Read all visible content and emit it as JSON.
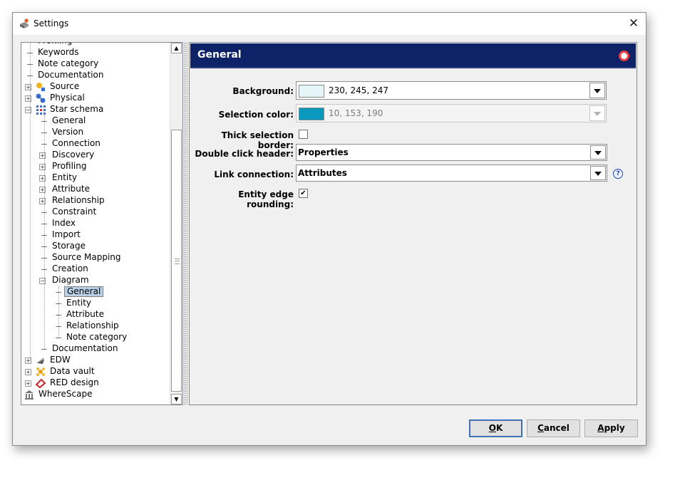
{
  "window": {
    "title": "Settings",
    "close_glyph": "✕"
  },
  "tree": {
    "items": [
      {
        "label": "Profiling",
        "level": 0,
        "expander": "",
        "icon": ""
      },
      {
        "label": "Keywords",
        "level": 0,
        "expander": "",
        "icon": ""
      },
      {
        "label": "Note category",
        "level": 0,
        "expander": "",
        "icon": ""
      },
      {
        "label": "Documentation",
        "level": 0,
        "expander": "",
        "icon": ""
      },
      {
        "label": "Source",
        "level": 0,
        "expander": "+",
        "icon": "source-icon"
      },
      {
        "label": "Physical",
        "level": 0,
        "expander": "+",
        "icon": "physical-icon"
      },
      {
        "label": "Star schema",
        "level": 0,
        "expander": "-",
        "icon": "star-schema-icon"
      },
      {
        "label": "General",
        "level": 1,
        "expander": "",
        "icon": ""
      },
      {
        "label": "Version",
        "level": 1,
        "expander": "",
        "icon": ""
      },
      {
        "label": "Connection",
        "level": 1,
        "expander": "",
        "icon": ""
      },
      {
        "label": "Discovery",
        "level": 1,
        "expander": "+",
        "icon": ""
      },
      {
        "label": "Profiling",
        "level": 1,
        "expander": "+",
        "icon": ""
      },
      {
        "label": "Entity",
        "level": 1,
        "expander": "+",
        "icon": ""
      },
      {
        "label": "Attribute",
        "level": 1,
        "expander": "+",
        "icon": ""
      },
      {
        "label": "Relationship",
        "level": 1,
        "expander": "+",
        "icon": ""
      },
      {
        "label": "Constraint",
        "level": 1,
        "expander": "",
        "icon": ""
      },
      {
        "label": "Index",
        "level": 1,
        "expander": "",
        "icon": ""
      },
      {
        "label": "Import",
        "level": 1,
        "expander": "",
        "icon": ""
      },
      {
        "label": "Storage",
        "level": 1,
        "expander": "",
        "icon": ""
      },
      {
        "label": "Source Mapping",
        "level": 1,
        "expander": "",
        "icon": ""
      },
      {
        "label": "Creation",
        "level": 1,
        "expander": "",
        "icon": ""
      },
      {
        "label": "Diagram",
        "level": 1,
        "expander": "-",
        "icon": ""
      },
      {
        "label": "General",
        "level": 2,
        "expander": "",
        "icon": "",
        "selected": true
      },
      {
        "label": "Entity",
        "level": 2,
        "expander": "",
        "icon": ""
      },
      {
        "label": "Attribute",
        "level": 2,
        "expander": "",
        "icon": ""
      },
      {
        "label": "Relationship",
        "level": 2,
        "expander": "",
        "icon": ""
      },
      {
        "label": "Note category",
        "level": 2,
        "expander": "",
        "icon": ""
      },
      {
        "label": "Documentation",
        "level": 1,
        "expander": "",
        "icon": ""
      },
      {
        "label": "EDW",
        "level": 0,
        "expander": "+",
        "icon": "edw-icon"
      },
      {
        "label": "Data vault",
        "level": 0,
        "expander": "+",
        "icon": "data-vault-icon"
      },
      {
        "label": "RED design",
        "level": 0,
        "expander": "+",
        "icon": "red-design-icon"
      },
      {
        "label": "WhereScape",
        "level": -1,
        "expander": "",
        "icon": "wherescape-icon"
      }
    ]
  },
  "panel": {
    "title": "General",
    "fields": {
      "background": {
        "label": "Background:",
        "value": "230, 245, 247",
        "color": "#e6f5f7"
      },
      "selection_color": {
        "label": "Selection color:",
        "value": "10, 153, 190",
        "color": "#0a99be"
      },
      "thick_selection_border": {
        "label": "Thick selection border:",
        "checked": false
      },
      "double_click_header": {
        "label": "Double click header:",
        "value": "Properties"
      },
      "link_connection": {
        "label": "Link connection:",
        "value": "Attributes"
      },
      "entity_edge_rounding": {
        "label": "Entity edge rounding:",
        "checked": true
      }
    }
  },
  "buttons": {
    "ok": {
      "u": "O",
      "rest": "K"
    },
    "cancel": {
      "u": "C",
      "rest": "ancel"
    },
    "apply": {
      "u": "A",
      "rest": "pply"
    }
  },
  "colors": {
    "header_bg": "#0e2367",
    "selected_row": "#b8cfe5"
  }
}
